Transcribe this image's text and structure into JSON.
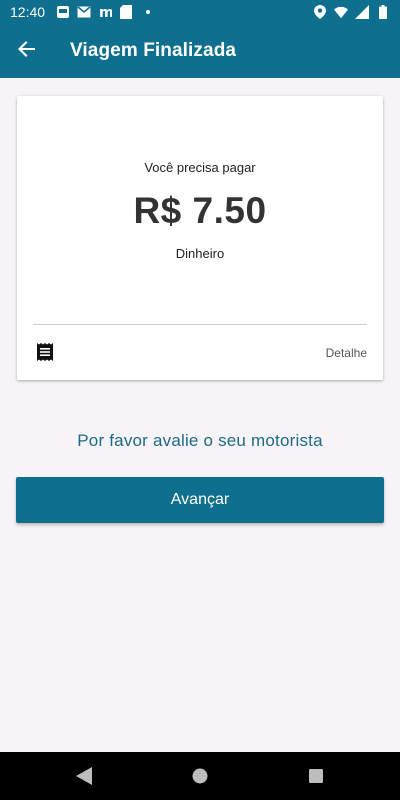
{
  "status_bar": {
    "time": "12:40",
    "left_icons": [
      "mail-icon",
      "m-app-icon",
      "sd-card-icon"
    ],
    "right_icons": [
      "location-icon",
      "wifi-icon",
      "signal-icon",
      "battery-icon"
    ]
  },
  "app_bar": {
    "title": "Viagem Finalizada",
    "back_icon": "arrow-back-icon",
    "background": "#0f6f8f"
  },
  "payment_card": {
    "label": "Você precisa pagar",
    "amount": "R$ 7.50",
    "method": "Dinheiro",
    "detail_label": "Detalhe",
    "receipt_icon": "receipt-icon"
  },
  "rate_prompt": "Por favor avalie o seu motorista",
  "advance_button": {
    "label": "Avançar",
    "background": "#0f6f8f"
  },
  "nav_bar": {
    "icons": [
      "back-triangle-icon",
      "home-circle-icon",
      "recents-square-icon"
    ]
  }
}
